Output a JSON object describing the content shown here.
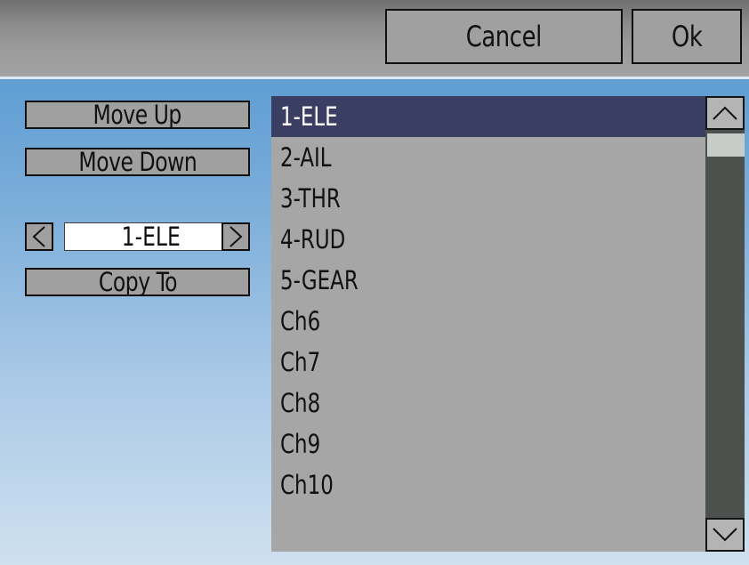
{
  "header": {
    "cancel_label": "Cancel",
    "ok_label": "Ok"
  },
  "side_panel": {
    "move_up_label": "Move Up",
    "move_down_label": "Move Down",
    "selector_value": "1-ELE",
    "copy_to_label": "Copy To"
  },
  "channel_list": {
    "selected_index": 0,
    "items": [
      "1-ELE",
      "2-AIL",
      "3-THR",
      "4-RUD",
      "5-GEAR",
      "Ch6",
      "Ch7",
      "Ch8",
      "Ch9",
      "Ch10"
    ]
  },
  "icons": {
    "spinner_left": "chevron-left-icon",
    "spinner_right": "chevron-right-icon",
    "scroll_up": "chevron-up-icon",
    "scroll_down": "chevron-down-icon"
  },
  "colors": {
    "selected_row_bg": "#3a3e63",
    "list_bg": "#a6a6a6",
    "button_bg": "#a0a0a0",
    "background_top": "#4d94cf",
    "background_bottom": "#cfe0ef"
  }
}
